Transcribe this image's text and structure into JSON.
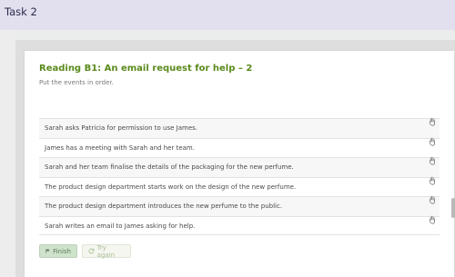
{
  "header": {
    "title": "Task 2"
  },
  "card": {
    "title": "Reading B1: An email request for help – 2",
    "instruction": "Put the events in order.",
    "items": [
      {
        "label": "Sarah asks Patricia for permission to use James."
      },
      {
        "label": "James has a meeting with Sarah and her team."
      },
      {
        "label": "Sarah and her team finalise the details of the packaging for the new perfume."
      },
      {
        "label": "The product design department starts work on the design of the new perfume."
      },
      {
        "label": "The product design department introduces the new perfume to the public."
      },
      {
        "label": "Sarah writes an email to James asking for help."
      }
    ]
  },
  "buttons": {
    "finish_label": "Finish",
    "try_again_label": "Try again"
  },
  "colors": {
    "header_bg": "#e2e0ef",
    "title_green": "#5a8a1c",
    "finish_bg": "#cfe2cc"
  }
}
